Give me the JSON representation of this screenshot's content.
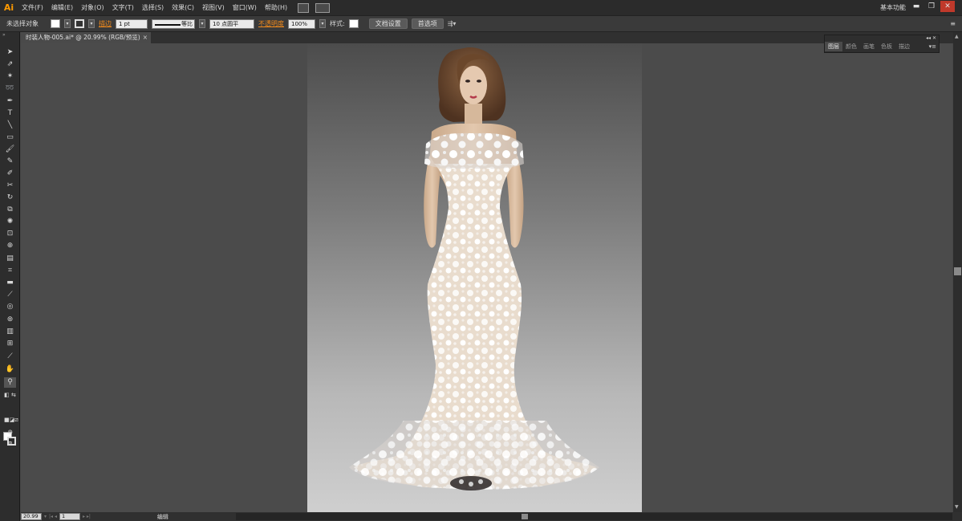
{
  "app": {
    "logo": "Ai",
    "workspace": "基本功能"
  },
  "menu": [
    "文件(F)",
    "编辑(E)",
    "对象(O)",
    "文字(T)",
    "选择(S)",
    "效果(C)",
    "视图(V)",
    "窗口(W)",
    "帮助(H)"
  ],
  "window_controls": {
    "minimize": "▬",
    "restore": "❐",
    "close": "✕"
  },
  "control": {
    "selection_status": "未选择对象",
    "stroke_label": "描边",
    "stroke_weight": "1 pt",
    "stroke_profile": "等比",
    "brush": "10 点圆平",
    "opacity_label": "不透明度",
    "opacity_value": "100%",
    "style_label": "样式:",
    "doc_setup": "文档设置",
    "preferences": "首选项"
  },
  "document_tab": {
    "title": "时装人物-005.ai* @ 20.99% (RGB/预览)",
    "close": "×"
  },
  "panel": {
    "tabs": [
      "图层",
      "颜色",
      "画笔",
      "色板",
      "描边"
    ],
    "active_index": 0
  },
  "status": {
    "zoom": "20.99",
    "artboard": "1",
    "label": "编辑"
  },
  "colors": {
    "accent": "#f08a1c",
    "dress": "#f6f3ef",
    "skin": "#dbbfa4",
    "hair": "#6e4a2c"
  }
}
